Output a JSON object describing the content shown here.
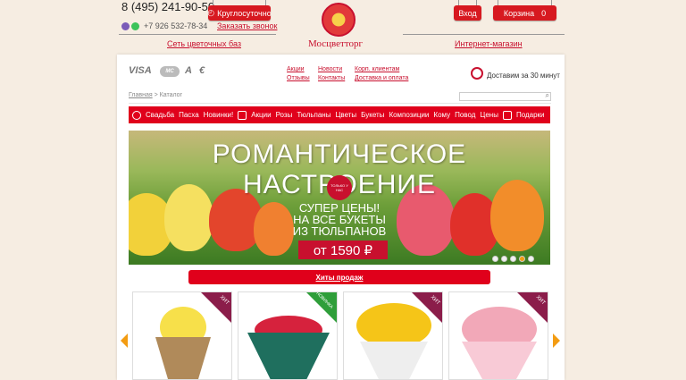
{
  "header": {
    "phone": "8 (495) 241-90-50",
    "phone2": "+7 926 532-78-34",
    "hours_btn": "Круглосуточно",
    "callback": "Заказать звонок",
    "stores_link": "Сеть цветочных баз",
    "login_btn": "Вход",
    "cart_btn": "Корзина",
    "cart_count": "0",
    "shop_link": "Интернет-магазин",
    "logo_text": "Мосцветторг"
  },
  "payments": [
    "VISA",
    "MC",
    "A",
    "€"
  ],
  "nav": {
    "col1": [
      "Акции",
      "Отзывы"
    ],
    "col2": [
      "Новости",
      "Контакты"
    ],
    "col3": [
      "Корп. клиентам",
      "Доставка и оплата"
    ]
  },
  "delivery": "Доставим за 30 минут",
  "breadcrumb": {
    "home": "Главная",
    "sep": ">",
    "current": "Каталог"
  },
  "categories": [
    "Свадьба",
    "Пасха",
    "Новинки!",
    "Акции",
    "Розы",
    "Тюльпаны",
    "Цветы",
    "Букеты",
    "Композиции",
    "Кому",
    "Повод",
    "Цены",
    "Подарки"
  ],
  "banner": {
    "title": "РОМАНТИЧЕСКОЕ НАСТРОЕНИЕ",
    "badge": "ТОЛЬКО У НАС",
    "promo_line1": "СУПЕР ЦЕНЫ!",
    "promo_line2": "НА ВСЕ БУКЕТЫ",
    "promo_line3": "ИЗ ТЮЛЬПАНОВ",
    "price": "от 1590 ₽"
  },
  "hits_title": "Хиты продаж",
  "products": [
    {
      "tag": "ХИТ",
      "colors": [
        "#f7e04a",
        "#ffffff",
        "#6d8b3a"
      ]
    },
    {
      "tag": "НОВИНКА",
      "colors": [
        "#d6223d",
        "#1f6f5e",
        "#203a4a"
      ]
    },
    {
      "tag": "ХИТ",
      "colors": [
        "#f5c518",
        "#ffffff",
        "#c0a8c8"
      ]
    },
    {
      "tag": "ХИТ",
      "colors": [
        "#f2a8b8",
        "#f8cad6",
        "#a5c46a"
      ]
    }
  ],
  "colors": {
    "accent": "#e0001b",
    "background": "#f6ede2",
    "link": "#c8102e"
  }
}
